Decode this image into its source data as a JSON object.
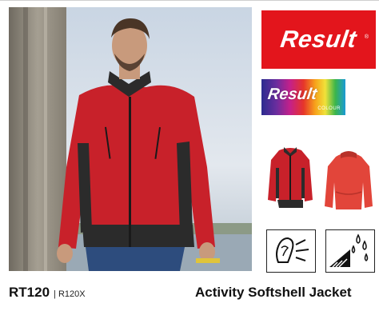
{
  "product": {
    "code": "RT120",
    "alt_code": "R120X",
    "separator": "|",
    "name": "Activity Softshell Jacket"
  },
  "brand": {
    "primary_logo_text": "Result",
    "primary_logo_mark": "®",
    "colour_logo_text": "Result",
    "colour_logo_subtext": "COLOUR",
    "colors": {
      "brand_red": "#e3151c",
      "jacket_red": "#c8212a",
      "jacket_black": "#2b2b2b"
    }
  },
  "icons": {
    "feature_1": "windproof-icon",
    "feature_2": "water-repellent-icon"
  }
}
